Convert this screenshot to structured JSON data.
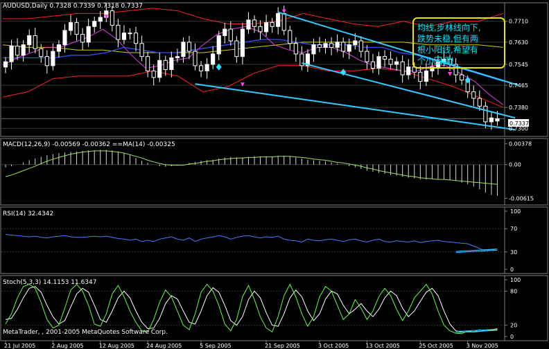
{
  "colors": {
    "background": "#000000",
    "panel_border": "#808080",
    "grid": "#3a3a3a",
    "bull_candle": "#ffffff",
    "bear_candle": "#ffffff",
    "bollinger": "#ff2020",
    "envelope": "#a0a000",
    "ma_short": "#e040e0",
    "ma_long": "#3050ff",
    "ma_mid": "#d0d000",
    "channel": "#33ccff",
    "macd_hist": "#d8d8d8",
    "macd_signal": "#ff3030",
    "macd_line": "#a0e060",
    "rsi": "#4080ff",
    "stoch_main": "#60ff40",
    "stoch_signal": "#ffffff",
    "annotation_border": "#e6e600",
    "annotation_text": "#00e5ff",
    "price_box": "#ffffff"
  },
  "chart_data": [
    {
      "type": "candlestick",
      "title": "AUDUSD,Daily  0.7328 0.7339 0.7318 0.7337",
      "ylim": [
        0.7285,
        0.7765
      ],
      "y_ticks": [
        "0.7710",
        "0.7630",
        "0.7545",
        "0.7465",
        "0.7380",
        "0.7300"
      ],
      "current_price": "0.7337",
      "x_ticks": [
        "21 Jul 2005",
        "2 Aug 2005",
        "12 Aug 2005",
        "24 Aug 2005",
        "5 Sep 2005",
        "21 Sep 2005",
        "3 Oct 2005",
        "13 Oct 2005",
        "25 Oct 2005",
        "3 Nov 2005"
      ],
      "close": [
        0.7555,
        0.7615,
        0.758,
        0.762,
        0.7655,
        0.7605,
        0.7575,
        0.754,
        0.7595,
        0.762,
        0.7675,
        0.7705,
        0.766,
        0.763,
        0.769,
        0.771,
        0.7725,
        0.775,
        0.7695,
        0.764,
        0.7665,
        0.7665,
        0.7625,
        0.7575,
        0.752,
        0.7495,
        0.756,
        0.7525,
        0.757,
        0.7575,
        0.763,
        0.7595,
        0.754,
        0.752,
        0.7545,
        0.7585,
        0.7655,
        0.768,
        0.7635,
        0.7575,
        0.768,
        0.7715,
        0.769,
        0.767,
        0.7705,
        0.769,
        0.774,
        0.7675,
        0.7625,
        0.7585,
        0.754,
        0.7585,
        0.762,
        0.761,
        0.7625,
        0.761,
        0.763,
        0.7595,
        0.762,
        0.7635,
        0.7595,
        0.7555,
        0.753,
        0.7575,
        0.7565,
        0.7545,
        0.7555,
        0.7505,
        0.7535,
        0.7515,
        0.748,
        0.752,
        0.7535,
        0.7555,
        0.7565,
        0.7545,
        0.7505,
        0.7485,
        0.744,
        0.7415,
        0.7385,
        0.7325,
        0.734,
        0.7337
      ],
      "open": [
        0.7535,
        0.7555,
        0.7615,
        0.758,
        0.762,
        0.7655,
        0.7605,
        0.7575,
        0.754,
        0.7595,
        0.762,
        0.7675,
        0.7705,
        0.766,
        0.763,
        0.769,
        0.771,
        0.7725,
        0.775,
        0.7695,
        0.764,
        0.7665,
        0.7665,
        0.7625,
        0.7575,
        0.752,
        0.7495,
        0.756,
        0.7525,
        0.757,
        0.7575,
        0.763,
        0.7595,
        0.754,
        0.752,
        0.7545,
        0.7585,
        0.7655,
        0.768,
        0.7635,
        0.7575,
        0.768,
        0.7715,
        0.769,
        0.767,
        0.7705,
        0.769,
        0.774,
        0.7675,
        0.7625,
        0.7585,
        0.754,
        0.7585,
        0.762,
        0.761,
        0.7625,
        0.761,
        0.763,
        0.7595,
        0.762,
        0.7635,
        0.7595,
        0.7555,
        0.753,
        0.7575,
        0.7565,
        0.7545,
        0.7555,
        0.7505,
        0.7535,
        0.7515,
        0.748,
        0.752,
        0.7535,
        0.7555,
        0.7565,
        0.7545,
        0.7505,
        0.7485,
        0.744,
        0.7415,
        0.7385,
        0.7325,
        0.7328
      ],
      "bollinger_upper_level": [
        0.772,
        0.772,
        0.773,
        0.774,
        0.774,
        0.775,
        0.776,
        0.775,
        0.772,
        0.77,
        0.77,
        0.771,
        0.774,
        0.772,
        0.77,
        0.769,
        0.771,
        0.769,
        0.771,
        0.771,
        0.774
      ],
      "bollinger_lower_level": [
        0.742,
        0.744,
        0.749,
        0.75,
        0.75,
        0.75,
        0.752,
        0.75,
        0.744,
        0.746,
        0.751,
        0.754,
        0.754,
        0.752,
        0.752,
        0.753,
        0.752,
        0.749,
        0.746,
        0.742,
        0.738
      ],
      "ma_short_level": [
        0.754,
        0.757,
        0.759,
        0.761,
        0.761,
        0.763,
        0.765,
        0.768,
        0.764,
        0.758,
        0.753,
        0.754,
        0.756,
        0.757,
        0.762,
        0.766,
        0.768,
        0.769,
        0.767,
        0.762,
        0.76,
        0.759,
        0.761,
        0.761,
        0.759,
        0.756,
        0.754,
        0.753,
        0.752,
        0.752,
        0.754,
        0.754,
        0.751,
        0.748,
        0.743,
        0.739
      ],
      "ma_long_level": [
        0.757,
        0.757,
        0.757,
        0.757,
        0.758,
        0.758,
        0.759,
        0.761,
        0.76,
        0.759,
        0.759,
        0.76,
        0.761,
        0.762,
        0.763,
        0.764,
        0.764,
        0.763,
        0.762,
        0.762,
        0.762,
        0.761,
        0.761,
        0.759,
        0.758,
        0.756,
        0.754,
        0.752,
        0.75,
        0.748
      ],
      "ma_mid_level": [
        0.762,
        0.761,
        0.761,
        0.76,
        0.76,
        0.759,
        0.759,
        0.759,
        0.759,
        0.76,
        0.761,
        0.762,
        0.763,
        0.763,
        0.763,
        0.763,
        0.763,
        0.762,
        0.762,
        0.762,
        0.761
      ],
      "up_arrows": [
        [
          36,
          0.7535
        ],
        [
          57,
          0.7515
        ],
        [
          78,
          0.7485
        ]
      ],
      "down_arrows": [
        [
          17,
          0.7725
        ],
        [
          40,
          0.7465
        ],
        [
          47,
          0.7745
        ],
        [
          75,
          0.7505
        ]
      ],
      "annotation": {
        "lines": [
          "均线,步林线向下,",
          "跌势未稳,但有两",
          "根小阳线,希望有",
          "个小回调!"
        ]
      }
    },
    {
      "type": "histogram",
      "title": "MACD(12,26,9) -0.00569 -0.00362 ==MA(14) -0.00325",
      "ylim": [
        -0.0066,
        0.004
      ],
      "y_ticks": [
        "0.00378",
        "0.00",
        "-0.00615"
      ],
      "hist": [
        -0.0005,
        -0.0003,
        0.0,
        0.0004,
        0.0008,
        0.0011,
        0.0014,
        0.0017,
        0.0019,
        0.0021,
        0.0022,
        0.0023,
        0.0024,
        0.0025,
        0.0026,
        0.0026,
        0.0027,
        0.0027,
        0.0026,
        0.0024,
        0.0021,
        0.0017,
        0.0012,
        0.0007,
        0.0003,
        0.0,
        -0.0003,
        -0.0004,
        -0.0003,
        -0.0002,
        0.0,
        0.0003,
        0.0005,
        0.0007,
        0.0008,
        0.0009,
        0.0011,
        0.0013,
        0.0014,
        0.0013,
        0.0013,
        0.0014,
        0.0015,
        0.0015,
        0.0015,
        0.0015,
        0.0016,
        0.0016,
        0.0015,
        0.0013,
        0.0011,
        0.0009,
        0.0008,
        0.0007,
        0.0006,
        0.0004,
        0.0002,
        0.0,
        -0.0003,
        -0.0005,
        -0.0008,
        -0.0011,
        -0.0013,
        -0.0015,
        -0.0017,
        -0.0019,
        -0.002,
        -0.0022,
        -0.0024,
        -0.0025,
        -0.0027,
        -0.0027,
        -0.0026,
        -0.0026,
        -0.0027,
        -0.0028,
        -0.003,
        -0.0033,
        -0.0036,
        -0.004,
        -0.0045,
        -0.0051,
        -0.0055,
        -0.0057
      ],
      "signal": [
        -0.0022,
        -0.0019,
        -0.0015,
        -0.0011,
        -0.0007,
        -0.0003,
        0.0002,
        0.0006,
        0.001,
        0.0013,
        0.0016,
        0.0019,
        0.0021,
        0.0023,
        0.0024,
        0.0025,
        0.0025,
        0.0025,
        0.0024,
        0.0023,
        0.0021,
        0.0018,
        0.0015,
        0.0012,
        0.0008,
        0.0005,
        0.0002,
        0.0,
        -0.0001,
        -0.0001,
        -0.0001,
        0.0001,
        0.0002,
        0.0004,
        0.0006,
        0.0007,
        0.0009,
        0.001,
        0.0011,
        0.0012,
        0.0012,
        0.0013,
        0.0013,
        0.0014,
        0.0014,
        0.0014,
        0.0015,
        0.0015,
        0.0015,
        0.0014,
        0.0013,
        0.0012,
        0.001,
        0.0009,
        0.0008,
        0.0006,
        0.0004,
        0.0003,
        0.0001,
        -0.0001,
        -0.0003,
        -0.0006,
        -0.0008,
        -0.0011,
        -0.0013,
        -0.0015,
        -0.0017,
        -0.0019,
        -0.0021,
        -0.0022,
        -0.0024,
        -0.0025,
        -0.0026,
        -0.0027,
        -0.0027,
        -0.0028,
        -0.0029,
        -0.003,
        -0.0031,
        -0.0032,
        -0.0033,
        -0.0034,
        -0.0035,
        -0.0036
      ]
    },
    {
      "type": "line",
      "title": "RSI(14) 32.4342",
      "ylim": [
        0,
        100
      ],
      "y_ticks": [
        "100",
        "70",
        "30",
        "0"
      ],
      "values": [
        60,
        59,
        58,
        57,
        56,
        57,
        55,
        54,
        56,
        57,
        58,
        56,
        55,
        55,
        56,
        57,
        56,
        57,
        55,
        53,
        52,
        50,
        52,
        48,
        50,
        48,
        52,
        54,
        56,
        52,
        50,
        54,
        48,
        52,
        54,
        56,
        58,
        56,
        52,
        55,
        57,
        58,
        56,
        54,
        56,
        55,
        57,
        52,
        50,
        49,
        47,
        52,
        50,
        49,
        51,
        52,
        50,
        48,
        51,
        52,
        49,
        47,
        50,
        52,
        48,
        47,
        49,
        48,
        47,
        49,
        46,
        48,
        49,
        50,
        48,
        47,
        46,
        45,
        44,
        40,
        36,
        32,
        34,
        32.4
      ],
      "trend_lines": [
        [
          [
            76,
            31
          ],
          [
            83,
            35
          ]
        ],
        [
          [
            76,
            29
          ],
          [
            83,
            33
          ]
        ]
      ]
    },
    {
      "type": "line",
      "title": "Stoch(5,3,3) 14.1153 11.6347",
      "ylim": [
        0,
        100
      ],
      "y_ticks": [
        "100",
        "80",
        "20",
        "0"
      ],
      "main": [
        22,
        40,
        68,
        88,
        92,
        85,
        60,
        30,
        15,
        20,
        50,
        82,
        92,
        80,
        55,
        22,
        18,
        40,
        75,
        90,
        70,
        45,
        25,
        10,
        8,
        30,
        60,
        82,
        70,
        45,
        20,
        12,
        40,
        78,
        92,
        80,
        55,
        22,
        10,
        30,
        70,
        90,
        65,
        35,
        15,
        8,
        35,
        72,
        92,
        70,
        40,
        18,
        35,
        70,
        88,
        80,
        55,
        30,
        40,
        65,
        50,
        30,
        45,
        70,
        85,
        72,
        48,
        28,
        45,
        68,
        80,
        92,
        75,
        45,
        20,
        10,
        6,
        5,
        10,
        8,
        12,
        10,
        12,
        14
      ],
      "signal": [
        30,
        32,
        48,
        68,
        85,
        88,
        78,
        55,
        35,
        22,
        28,
        52,
        75,
        85,
        78,
        55,
        30,
        25,
        45,
        68,
        80,
        68,
        45,
        25,
        14,
        15,
        32,
        58,
        72,
        66,
        45,
        25,
        22,
        45,
        72,
        86,
        78,
        55,
        28,
        20,
        35,
        65,
        80,
        68,
        42,
        20,
        18,
        40,
        68,
        82,
        70,
        45,
        28,
        40,
        66,
        80,
        75,
        55,
        40,
        48,
        58,
        45,
        35,
        48,
        68,
        80,
        72,
        50,
        35,
        45,
        62,
        78,
        85,
        72,
        45,
        22,
        10,
        8,
        8,
        8,
        9,
        10,
        11,
        11.6
      ],
      "trend_lines": [
        [
          [
            76,
            9
          ],
          [
            83,
            13
          ]
        ],
        [
          [
            76,
            7
          ],
          [
            83,
            11
          ]
        ]
      ]
    }
  ],
  "footer": {
    "copyright": "MetaTrader, , 2001-2005 MetaQuotes Software Corp."
  }
}
